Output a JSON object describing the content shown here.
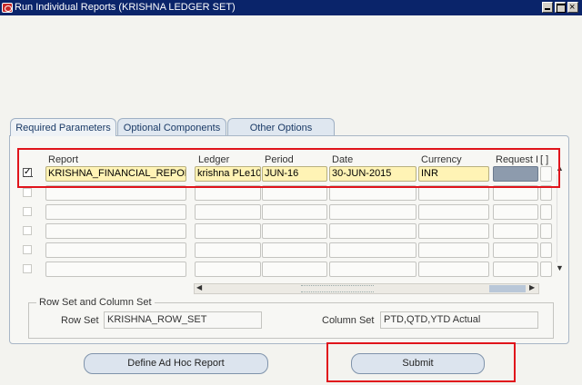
{
  "window": {
    "title": "Run Individual Reports (KRISHNA LEDGER SET)"
  },
  "tabs": [
    {
      "label": "Required Parameters"
    },
    {
      "label": "Optional Components"
    },
    {
      "label": "Other Options"
    }
  ],
  "table": {
    "headers": {
      "report": "Report",
      "ledger": "Ledger",
      "period": "Period",
      "date": "Date",
      "currency": "Currency",
      "request": "Request I",
      "extra": "[ ]"
    },
    "row1": {
      "checked": "✓",
      "report": "KRISHNA_FINANCIAL_REPORT",
      "ledger": "krishna PLe10",
      "period": "JUN-16",
      "date": "30-JUN-2015",
      "currency": "INR"
    }
  },
  "rowset": {
    "legend": "Row Set and Column Set",
    "row_set_label": "Row Set",
    "row_set_value": "KRISHNA_ROW_SET",
    "column_set_label": "Column Set",
    "column_set_value": "PTD,QTD,YTD Actual"
  },
  "buttons": {
    "define": "Define Ad Hoc Report",
    "submit": "Submit"
  }
}
